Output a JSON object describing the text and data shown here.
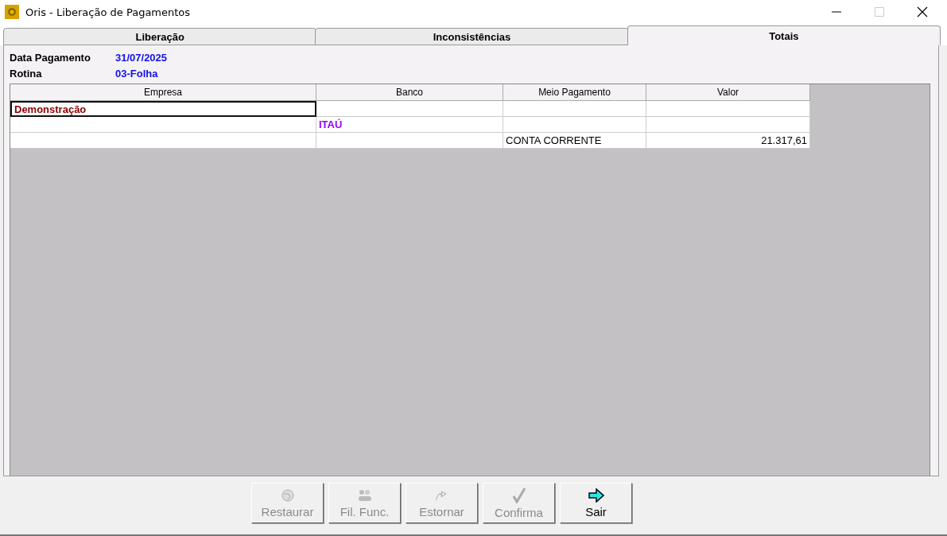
{
  "window": {
    "title": "Oris - Liberação de Pagamentos"
  },
  "tabs": [
    {
      "label": "Liberação",
      "selected": false
    },
    {
      "label": "Inconsistências",
      "selected": false
    },
    {
      "label": "Totais",
      "selected": true
    }
  ],
  "info": [
    {
      "label": "Data Pagamento",
      "value": "31/07/2025"
    },
    {
      "label": "Rotina",
      "value": "03-Folha"
    }
  ],
  "table": {
    "columns": [
      "Empresa",
      "Banco",
      "Meio Pagamento",
      "Valor"
    ],
    "rows": [
      {
        "kind": "company",
        "selected": true,
        "empresa": "Demonstração"
      },
      {
        "kind": "bank",
        "selected": false,
        "banco": "ITAÚ"
      },
      {
        "kind": "detail",
        "selected": false,
        "meio_pagamento": "CONTA CORRENTE",
        "valor": "21.317,61"
      }
    ]
  },
  "buttons": [
    {
      "kind": "globe",
      "label": "Restaurar",
      "disabled": true
    },
    {
      "kind": "people",
      "label": "Fil. Func.",
      "disabled": true
    },
    {
      "kind": "undo",
      "label": "Estornar",
      "disabled": true
    },
    {
      "kind": "check",
      "label": "Confirma",
      "disabled": true
    },
    {
      "kind": "arrow",
      "label": "Sair",
      "disabled": false
    }
  ]
}
